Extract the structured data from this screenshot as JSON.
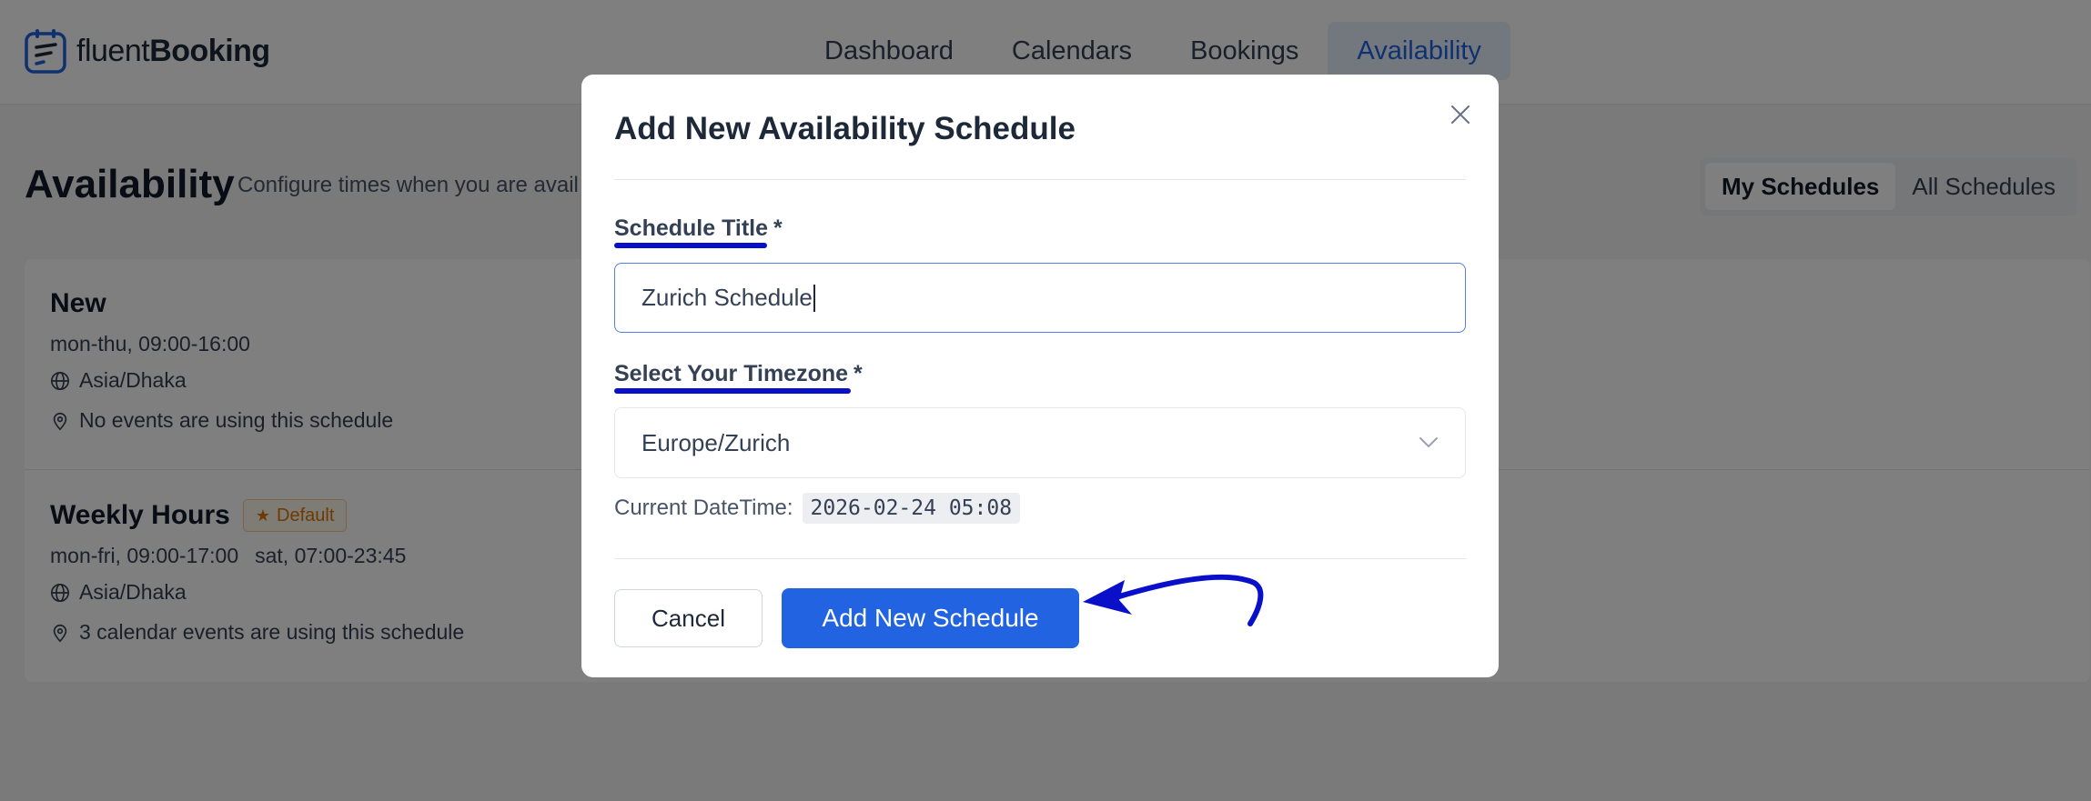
{
  "brand": {
    "name_thin": "fluent",
    "name_bold": "Booking",
    "logo_icon": "calendar-logo-icon"
  },
  "nav": {
    "items": [
      {
        "label": "Dashboard",
        "active": false
      },
      {
        "label": "Calendars",
        "active": false
      },
      {
        "label": "Bookings",
        "active": false
      },
      {
        "label": "Availability",
        "active": true
      }
    ]
  },
  "page": {
    "title": "Availability",
    "description": "Configure times when you are avail",
    "tabs": [
      {
        "label": "My Schedules",
        "active": true
      },
      {
        "label": "All Schedules",
        "active": false
      }
    ]
  },
  "schedules": [
    {
      "name": "New",
      "hours": [
        "mon-thu, 09:00-16:00"
      ],
      "timezone": "Asia/Dhaka",
      "usage": "No events are using this schedule",
      "badge": ""
    },
    {
      "name": "Weekly Hours",
      "hours": [
        "mon-fri, 09:00-17:00",
        "sat, 07:00-23:45"
      ],
      "timezone": "Asia/Dhaka",
      "usage": "3 calendar events are using this schedule",
      "badge": "Default"
    }
  ],
  "modal": {
    "title": "Add New Availability Schedule",
    "title_field": {
      "label": "Schedule Title",
      "required_mark": "*",
      "value": "Zurich Schedule"
    },
    "timezone_field": {
      "label": "Select Your Timezone",
      "required_mark": "*",
      "value": "Europe/Zurich"
    },
    "current_datetime_label": "Current DateTime:",
    "current_datetime_value": "2026-02-24 05:08",
    "cancel_label": "Cancel",
    "submit_label": "Add New Schedule"
  },
  "colors": {
    "accent": "#2163e0",
    "annotation": "#0a10c9",
    "badge": "#d97706"
  }
}
